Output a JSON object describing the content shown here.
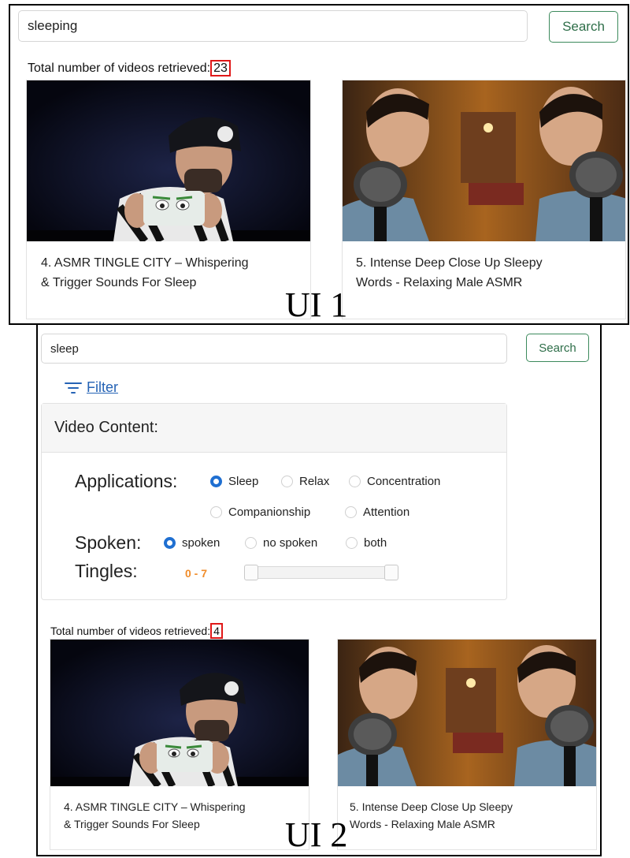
{
  "ui1": {
    "label": "UI 1",
    "search": {
      "value": "sleeping",
      "button_label": "Search"
    },
    "count_prefix": "Total number of videos retrieved:",
    "count_value": "23",
    "videos": [
      {
        "title_line1": "4. ASMR TINGLE CITY – Whispering",
        "title_line2": "& Trigger Sounds For Sleep"
      },
      {
        "title_line1": "5. Intense Deep Close Up Sleepy",
        "title_line2": "Words - Relaxing Male ASMR"
      }
    ]
  },
  "ui2": {
    "label": "UI 2",
    "search": {
      "value": "sleep",
      "button_label": "Search"
    },
    "filter_label": "Filter",
    "filter_panel": {
      "heading": "Video Content:",
      "applications": {
        "label": "Applications:",
        "options": [
          "Sleep",
          "Relax",
          "Concentration",
          "Companionship",
          "Attention"
        ],
        "selected": "Sleep"
      },
      "spoken": {
        "label": "Spoken:",
        "options": [
          "spoken",
          "no spoken",
          "both"
        ],
        "selected": "spoken"
      },
      "tingles": {
        "label": "Tingles:",
        "range_text": "0 - 7",
        "min": 0,
        "max": 7
      }
    },
    "count_prefix": "Total number of videos retrieved:",
    "count_value": "4",
    "videos": [
      {
        "title_line1": "4. ASMR TINGLE CITY – Whispering",
        "title_line2": "& Trigger Sounds For Sleep"
      },
      {
        "title_line1": "5. Intense Deep Close Up Sleepy",
        "title_line2": "Words - Relaxing Male ASMR"
      }
    ]
  },
  "colors": {
    "accent_blue": "#1f6fd1",
    "link_blue": "#2563b5",
    "search_green": "#2e6e49",
    "highlight_red": "#e01818",
    "range_orange": "#f08c2a"
  }
}
